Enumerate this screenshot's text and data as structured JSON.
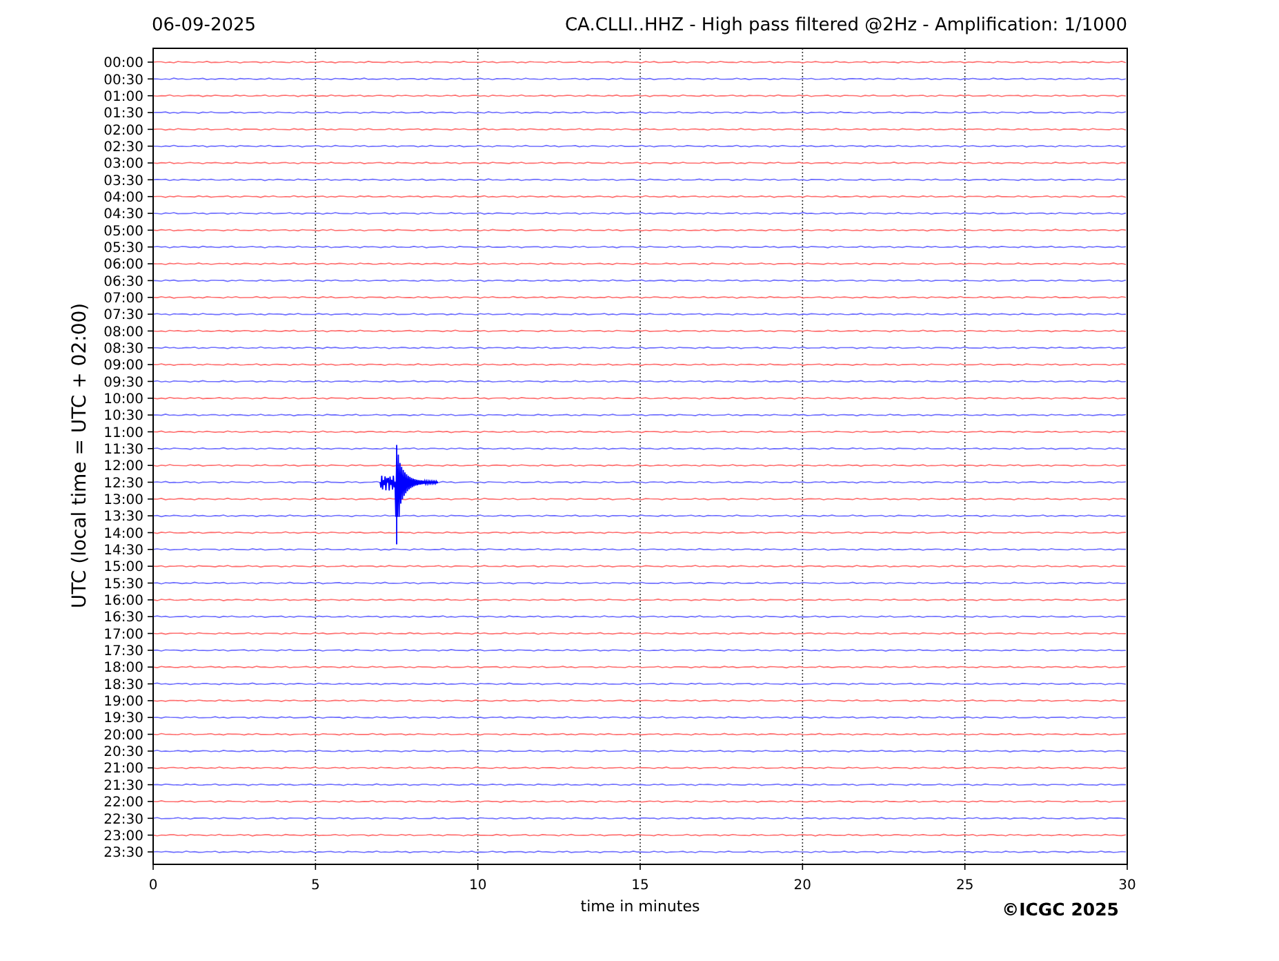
{
  "header": {
    "date": "06-09-2025",
    "title": "CA.CLLI..HHZ - High pass filtered @2Hz - Amplification: 1/1000"
  },
  "y_axis": {
    "label": "UTC (local time = UTC + 02:00)"
  },
  "rows": [
    {
      "label": "00:00",
      "color": "#ff6e6e"
    },
    {
      "label": "00:30",
      "color": "#6e6eff"
    },
    {
      "label": "01:00",
      "color": "#ff6e6e"
    },
    {
      "label": "01:30",
      "color": "#6e6eff"
    },
    {
      "label": "02:00",
      "color": "#ff6e6e"
    },
    {
      "label": "02:30",
      "color": "#6e6eff"
    },
    {
      "label": "03:00",
      "color": "#ff6e6e"
    },
    {
      "label": "03:30",
      "color": "#6e6eff"
    },
    {
      "label": "04:00",
      "color": "#ff6e6e"
    },
    {
      "label": "04:30",
      "color": "#6e6eff"
    },
    {
      "label": "05:00",
      "color": "#ff6e6e"
    },
    {
      "label": "05:30",
      "color": "#6e6eff"
    },
    {
      "label": "06:00",
      "color": "#ff6e6e"
    },
    {
      "label": "06:30",
      "color": "#6e6eff"
    },
    {
      "label": "07:00",
      "color": "#ff6e6e"
    },
    {
      "label": "07:30",
      "color": "#6e6eff"
    },
    {
      "label": "08:00",
      "color": "#ff6e6e"
    },
    {
      "label": "08:30",
      "color": "#6e6eff"
    },
    {
      "label": "09:00",
      "color": "#ff6e6e"
    },
    {
      "label": "09:30",
      "color": "#6e6eff"
    },
    {
      "label": "10:00",
      "color": "#ff6e6e"
    },
    {
      "label": "10:30",
      "color": "#6e6eff"
    },
    {
      "label": "11:00",
      "color": "#ff6e6e"
    },
    {
      "label": "11:30",
      "color": "#6e6eff"
    },
    {
      "label": "12:00",
      "color": "#ff6e6e"
    },
    {
      "label": "12:30",
      "color": "#6e6eff"
    },
    {
      "label": "13:00",
      "color": "#ff6e6e"
    },
    {
      "label": "13:30",
      "color": "#6e6eff"
    },
    {
      "label": "14:00",
      "color": "#ff6e6e"
    },
    {
      "label": "14:30",
      "color": "#6e6eff"
    },
    {
      "label": "15:00",
      "color": "#ff6e6e"
    },
    {
      "label": "15:30",
      "color": "#6e6eff"
    },
    {
      "label": "16:00",
      "color": "#ff6e6e"
    },
    {
      "label": "16:30",
      "color": "#6e6eff"
    },
    {
      "label": "17:00",
      "color": "#ff6e6e"
    },
    {
      "label": "17:30",
      "color": "#6e6eff"
    },
    {
      "label": "18:00",
      "color": "#ff6e6e"
    },
    {
      "label": "18:30",
      "color": "#6e6eff"
    },
    {
      "label": "19:00",
      "color": "#ff6e6e"
    },
    {
      "label": "19:30",
      "color": "#6e6eff"
    },
    {
      "label": "20:00",
      "color": "#ff6e6e"
    },
    {
      "label": "20:30",
      "color": "#6e6eff"
    },
    {
      "label": "21:00",
      "color": "#ff6e6e"
    },
    {
      "label": "21:30",
      "color": "#6e6eff"
    },
    {
      "label": "22:00",
      "color": "#ff6e6e"
    },
    {
      "label": "22:30",
      "color": "#6e6eff"
    },
    {
      "label": "23:00",
      "color": "#ff6e6e"
    },
    {
      "label": "23:30",
      "color": "#6e6eff"
    }
  ],
  "x_axis": {
    "label": "time in minutes",
    "ticks": [
      "0",
      "5",
      "10",
      "15",
      "20",
      "25",
      "30"
    ]
  },
  "copyright": "©ICGC 2025"
}
